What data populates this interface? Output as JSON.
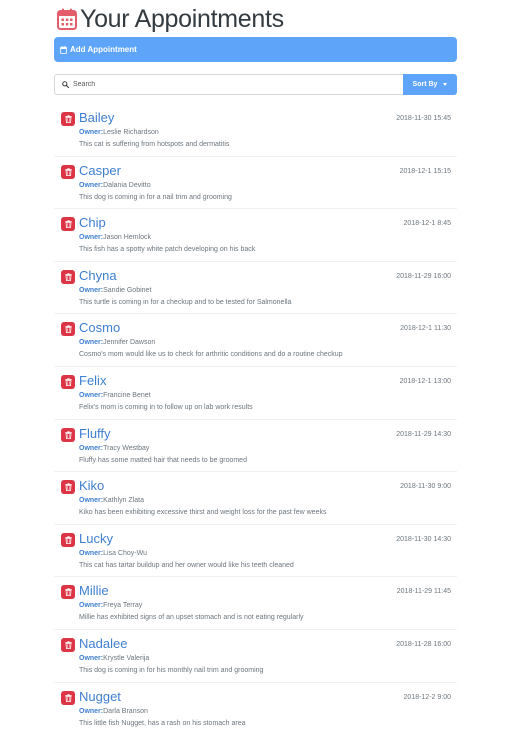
{
  "header": {
    "title": "Your Appointments",
    "icon": "calendar-icon",
    "icon_color": "#e35d6a"
  },
  "add_appointment": {
    "label": "Add Appointment",
    "icon": "calendar-icon"
  },
  "search": {
    "placeholder": "Search",
    "icon": "search-icon"
  },
  "sort": {
    "label": "Sort By",
    "icon": "caret-down-icon"
  },
  "owner_label": "Owner:",
  "appointments": [
    {
      "pet": "Bailey",
      "date": "2018-11-30 15:45",
      "owner": "Leslie Richardson",
      "notes": "This cat is suffering from hotspots and dermatitis"
    },
    {
      "pet": "Casper",
      "date": "2018-12-1 15:15",
      "owner": "Dalania Devitto",
      "notes": "This dog is coming in for a nail trim and grooming"
    },
    {
      "pet": "Chip",
      "date": "2018-12-1 8:45",
      "owner": "Jason Hemlock",
      "notes": "This fish has a spotty white patch developing on his back"
    },
    {
      "pet": "Chyna",
      "date": "2018-11-29 16:00",
      "owner": "Sandie Gobinet",
      "notes": "This turtle is coming in for a checkup and to be tested for Salmonella"
    },
    {
      "pet": "Cosmo",
      "date": "2018-12-1 11:30",
      "owner": "Jennifer Dawson",
      "notes": "Cosmo's mom would like us to check for arthritic conditions and do a routine checkup"
    },
    {
      "pet": "Felix",
      "date": "2018-12-1 13:00",
      "owner": "Francine Benet",
      "notes": "Felix's mom is coming in to follow up on lab work results"
    },
    {
      "pet": "Fluffy",
      "date": "2018-11-29 14:30",
      "owner": "Tracy Westbay",
      "notes": "Fluffy has some matted hair that needs to be groomed"
    },
    {
      "pet": "Kiko",
      "date": "2018-11-30 9:00",
      "owner": "Kathlyn Zlata",
      "notes": "Kiko has been exhibiting excessive thirst and weight loss for the past few weeks"
    },
    {
      "pet": "Lucky",
      "date": "2018-11-30 14:30",
      "owner": "Lisa Choy-Wu",
      "notes": "This cat has tartar buildup and her owner would like his teeth cleaned"
    },
    {
      "pet": "Millie",
      "date": "2018-11-29 11:45",
      "owner": "Freya Terray",
      "notes": "Millie has exhibited signs of an upset stomach and is not eating regularly"
    },
    {
      "pet": "Nadalee",
      "date": "2018-11-28 16:00",
      "owner": "Krystle Valerija",
      "notes": "This dog is coming in for his monthly nail trim and grooming"
    },
    {
      "pet": "Nugget",
      "date": "2018-12-2 9:00",
      "owner": "Darla Branson",
      "notes": "This little fish Nugget, has a rash on his stomach area"
    }
  ],
  "colors": {
    "accent": "#5ea4f8",
    "pet_name": "#3f7fd0",
    "delete": "#dc3545"
  }
}
